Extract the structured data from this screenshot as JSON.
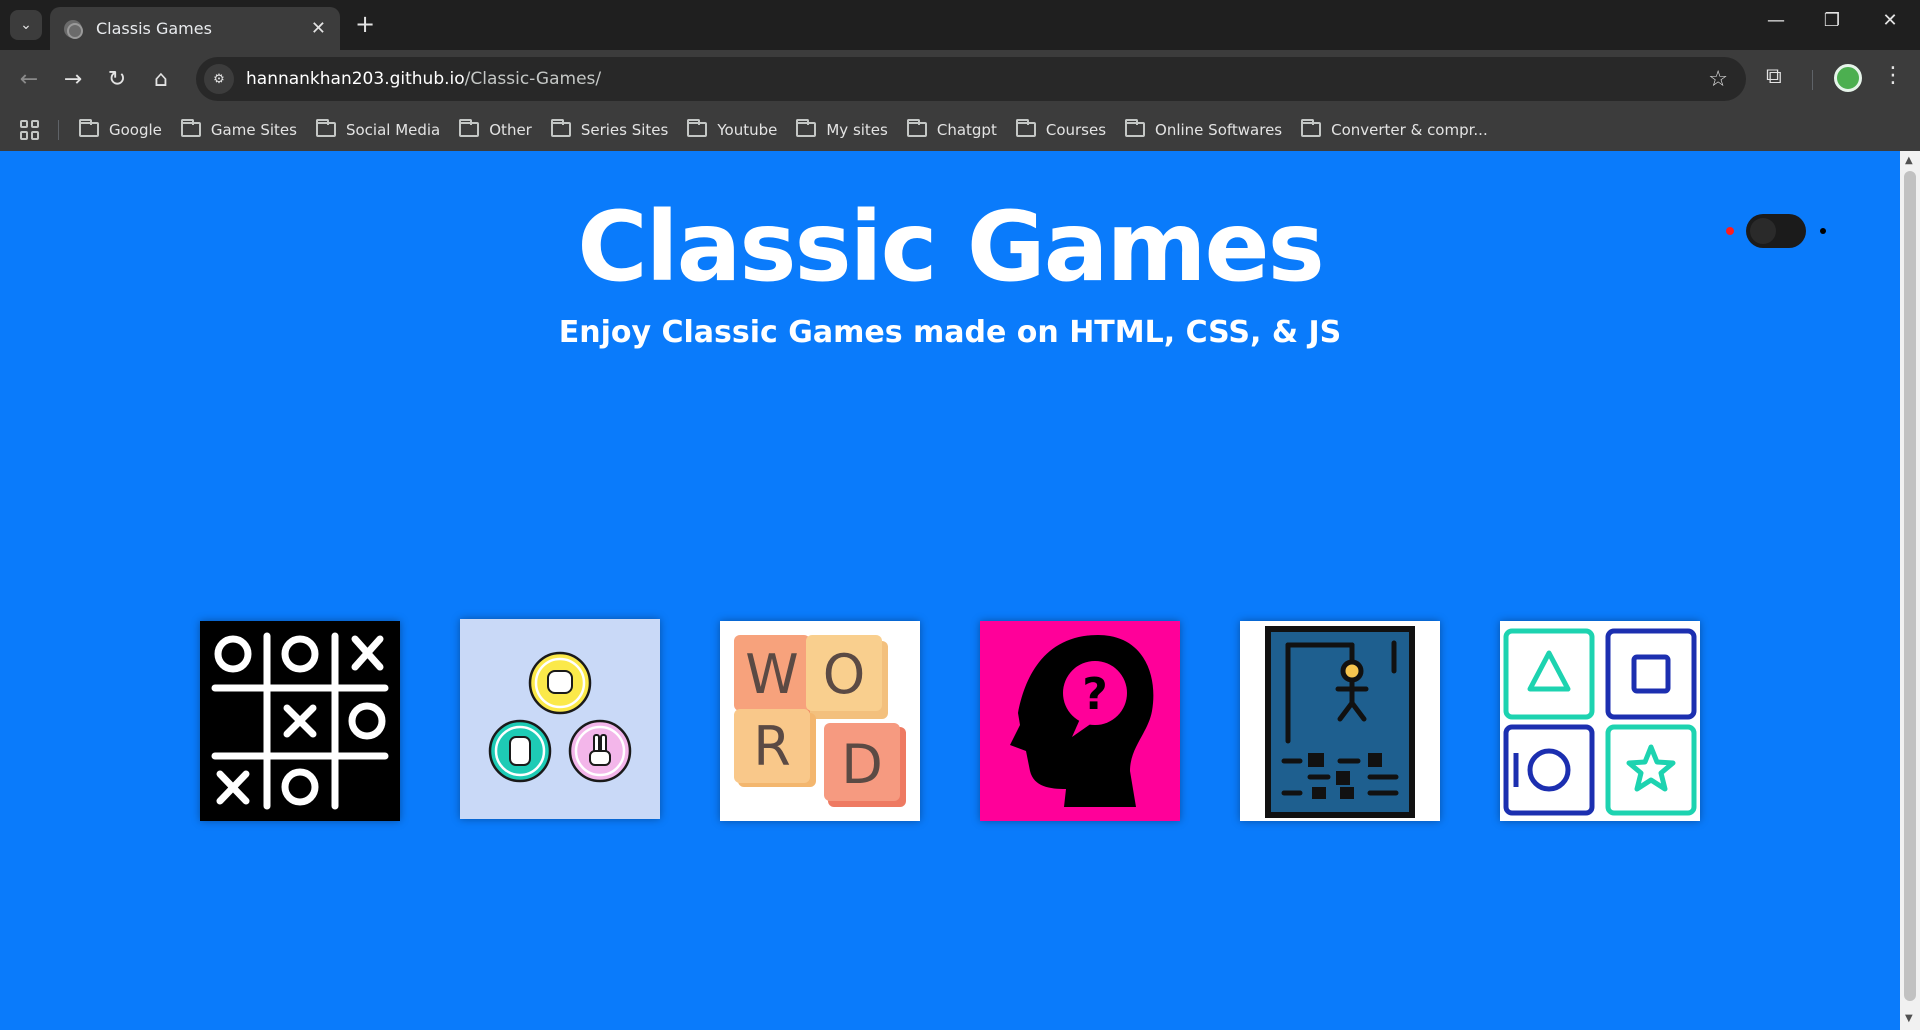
{
  "browser": {
    "tab_title": "Classis Games",
    "url_host": "hannankhan203.github.io",
    "url_path": "/Classic-Games/",
    "bookmarks": [
      "Google",
      "Game Sites",
      "Social Media",
      "Other",
      "Series Sites",
      "Youtube",
      "My sites",
      "Chatgpt",
      "Courses",
      "Online Softwares",
      "Converter & compr..."
    ]
  },
  "page": {
    "title": "Classic Games",
    "subtitle": "Enjoy Classic Games made on HTML, CSS, & JS",
    "background": "#0a7bfb",
    "theme_toggle": "off"
  },
  "games": [
    {
      "icon": "tic-tac-toe-icon",
      "bg": "#000000"
    },
    {
      "icon": "rock-paper-scissors-icon",
      "bg": "#c9d9f7"
    },
    {
      "icon": "word-game-icon",
      "bg": "#ffffff",
      "letters": [
        "W",
        "O",
        "R",
        "D"
      ]
    },
    {
      "icon": "quiz-head-icon",
      "bg": "#ff0099"
    },
    {
      "icon": "hangman-icon",
      "bg": "#ffffff"
    },
    {
      "icon": "memory-shapes-icon",
      "bg": "#ffffff"
    }
  ]
}
